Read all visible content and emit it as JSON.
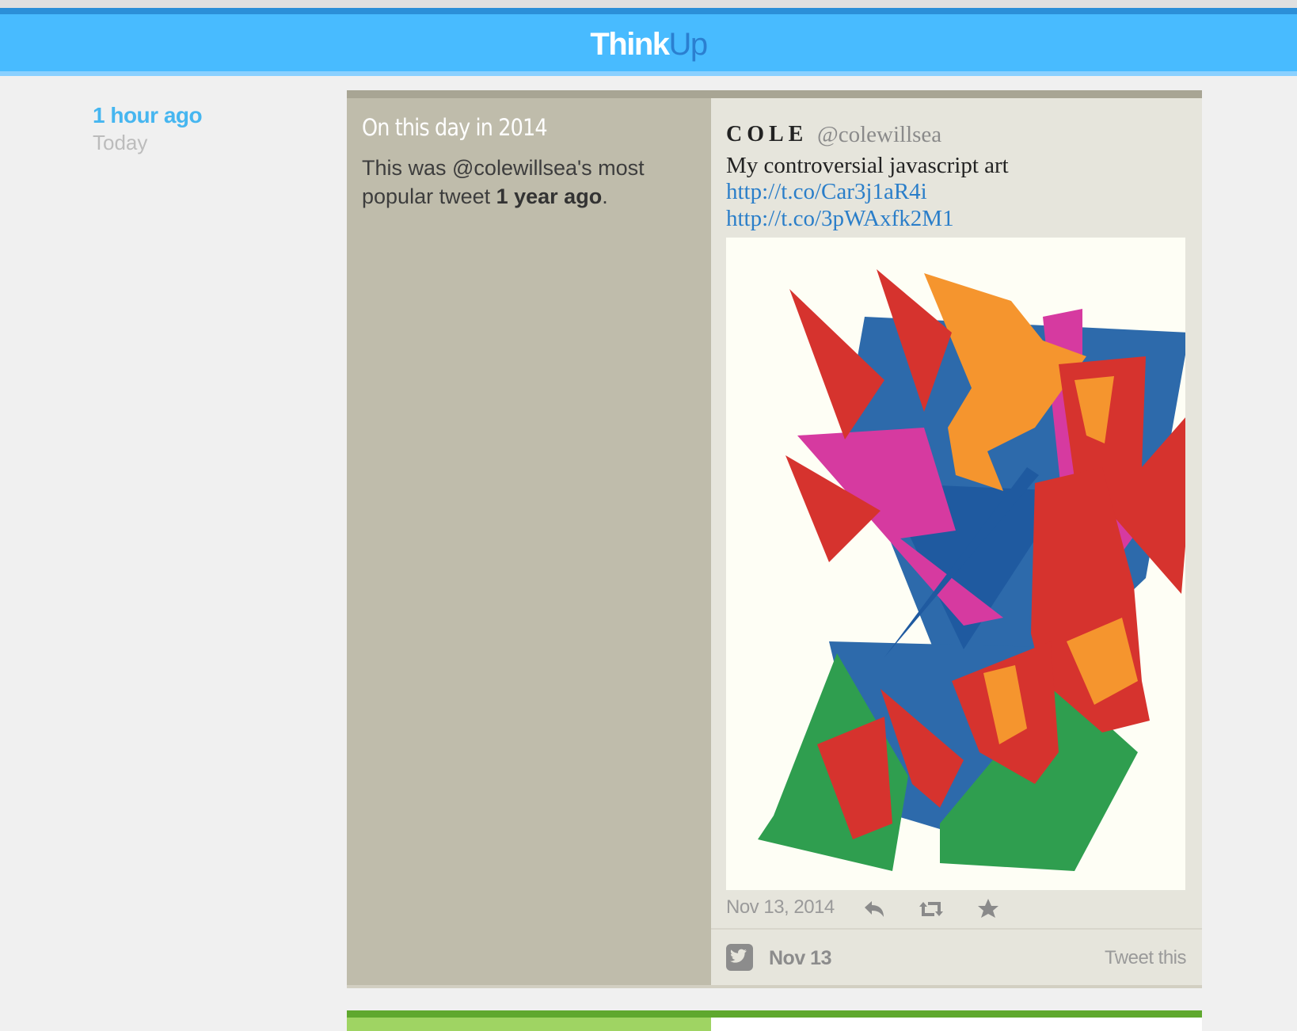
{
  "header": {
    "logo_think": "Think",
    "logo_up": "Up"
  },
  "insight": {
    "timestamp": "1 hour ago",
    "day": "Today",
    "title": "On this day in 2014",
    "desc_prefix": "This was @colewillsea's most popular tweet ",
    "desc_bold": "1 year ago",
    "desc_suffix": "."
  },
  "tweet": {
    "name": "COLE",
    "handle": "@colewillsea",
    "text": "My controversial javascript art",
    "links": [
      "http://t.co/Car3j1aR4i",
      "http://t.co/3pWAxfk2M1"
    ],
    "date": "Nov 13, 2014",
    "actions": {
      "reply_icon": "reply-icon",
      "retweet_icon": "retweet-icon",
      "favorite_icon": "star-icon"
    }
  },
  "footer": {
    "date": "Nov 13",
    "share": "Tweet this",
    "network_icon": "twitter-icon"
  },
  "colors": {
    "header_bg": "#48bbff",
    "accent_blue": "#46b6f0",
    "card_bg": "#bfbcab",
    "tweet_bg": "#e6e5dc",
    "link": "#2a7ec9",
    "next_card_accent": "#5fa82e"
  }
}
